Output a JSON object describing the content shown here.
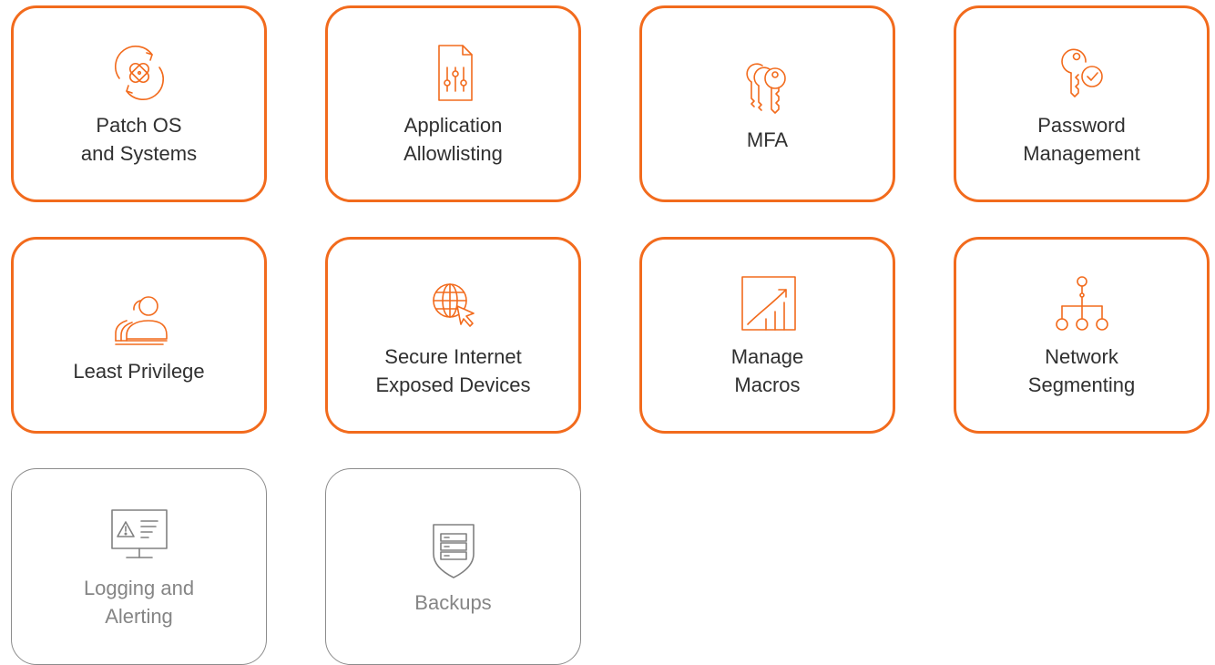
{
  "colors": {
    "accent": "#f26b1d",
    "inactive": "#8c8c8c",
    "active_text": "#303030",
    "inactive_text": "#858585"
  },
  "tiles": [
    {
      "label": "Patch OS\nand Systems",
      "icon": "patch-refresh-icon",
      "state": "active"
    },
    {
      "label": "Application\nAllowlisting",
      "icon": "file-sliders-icon",
      "state": "active"
    },
    {
      "label": "MFA",
      "icon": "multiple-keys-icon",
      "state": "active"
    },
    {
      "label": "Password\nManagement",
      "icon": "key-check-icon",
      "state": "active"
    },
    {
      "label": "Least Privilege",
      "icon": "user-group-icon",
      "state": "active"
    },
    {
      "label": "Secure Internet\nExposed Devices",
      "icon": "globe-cursor-icon",
      "state": "active"
    },
    {
      "label": "Manage\nMacros",
      "icon": "growth-chart-icon",
      "state": "active"
    },
    {
      "label": "Network\nSegmenting",
      "icon": "network-tree-icon",
      "state": "active"
    },
    {
      "label": "Logging and\nAlerting",
      "icon": "monitor-alert-icon",
      "state": "inactive"
    },
    {
      "label": "Backups",
      "icon": "shield-server-icon",
      "state": "inactive"
    }
  ]
}
